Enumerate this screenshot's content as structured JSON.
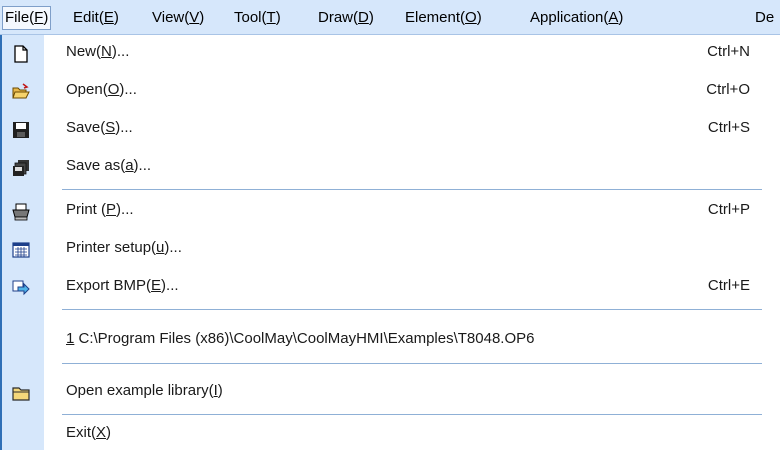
{
  "menubar": {
    "items": [
      {
        "text": "File(F)",
        "before": "File(",
        "key": "F",
        "after": ")"
      },
      {
        "text": "Edit(E)",
        "before": "Edit(",
        "key": "E",
        "after": ")"
      },
      {
        "text": "View(V)",
        "before": "View(",
        "key": "V",
        "after": ")"
      },
      {
        "text": "Tool(T)",
        "before": "Tool(",
        "key": "T",
        "after": ")"
      },
      {
        "text": "Draw(D)",
        "before": "Draw(",
        "key": "D",
        "after": ")"
      },
      {
        "text": "Element(O)",
        "before": "Element(",
        "key": "O",
        "after": ")"
      },
      {
        "text": "Application(A)",
        "before": "Application(",
        "key": "A",
        "after": ")"
      },
      {
        "text": "De",
        "before": "De",
        "key": "",
        "after": ""
      }
    ]
  },
  "file_menu": {
    "items": [
      {
        "before": "New(",
        "key": "N",
        "after": ")...",
        "shortcut": "Ctrl+N",
        "icon": "new-document-icon"
      },
      {
        "before": "Open(",
        "key": "O",
        "after": ")...",
        "shortcut": "Ctrl+O",
        "icon": "open-folder-icon"
      },
      {
        "before": "Save(",
        "key": "S",
        "after": ")...",
        "shortcut": "Ctrl+S",
        "icon": "floppy-disk-icon"
      },
      {
        "before": "Save as(",
        "key": "a",
        "after": ")...",
        "shortcut": "",
        "icon": "save-as-icon"
      },
      {
        "before": "Print (",
        "key": "P",
        "after": ")...",
        "shortcut": "Ctrl+P",
        "icon": "printer-icon"
      },
      {
        "before": "Printer setup(",
        "key": "u",
        "after": ")...",
        "shortcut": "",
        "icon": "printer-setup-icon"
      },
      {
        "before": "Export BMP(",
        "key": "E",
        "after": ")...",
        "shortcut": "Ctrl+E",
        "icon": "export-arrow-icon"
      },
      {
        "before": "",
        "key": "1",
        "after": " C:\\Program Files (x86)\\CoolMay\\CoolMayHMI\\Examples\\T8048.OP6",
        "shortcut": "",
        "icon": ""
      },
      {
        "before": "Open example library(",
        "key": "I",
        "after": ")",
        "shortcut": "",
        "icon": "folder-icon"
      },
      {
        "before": "Exit(",
        "key": "X",
        "after": ")",
        "shortcut": "",
        "icon": ""
      }
    ]
  },
  "colors": {
    "menubar_bg": "#d6e7fb",
    "gutter_bg": "#d6e7fb",
    "separator": "#8fb0d6",
    "accent": "#2f6fb6"
  }
}
